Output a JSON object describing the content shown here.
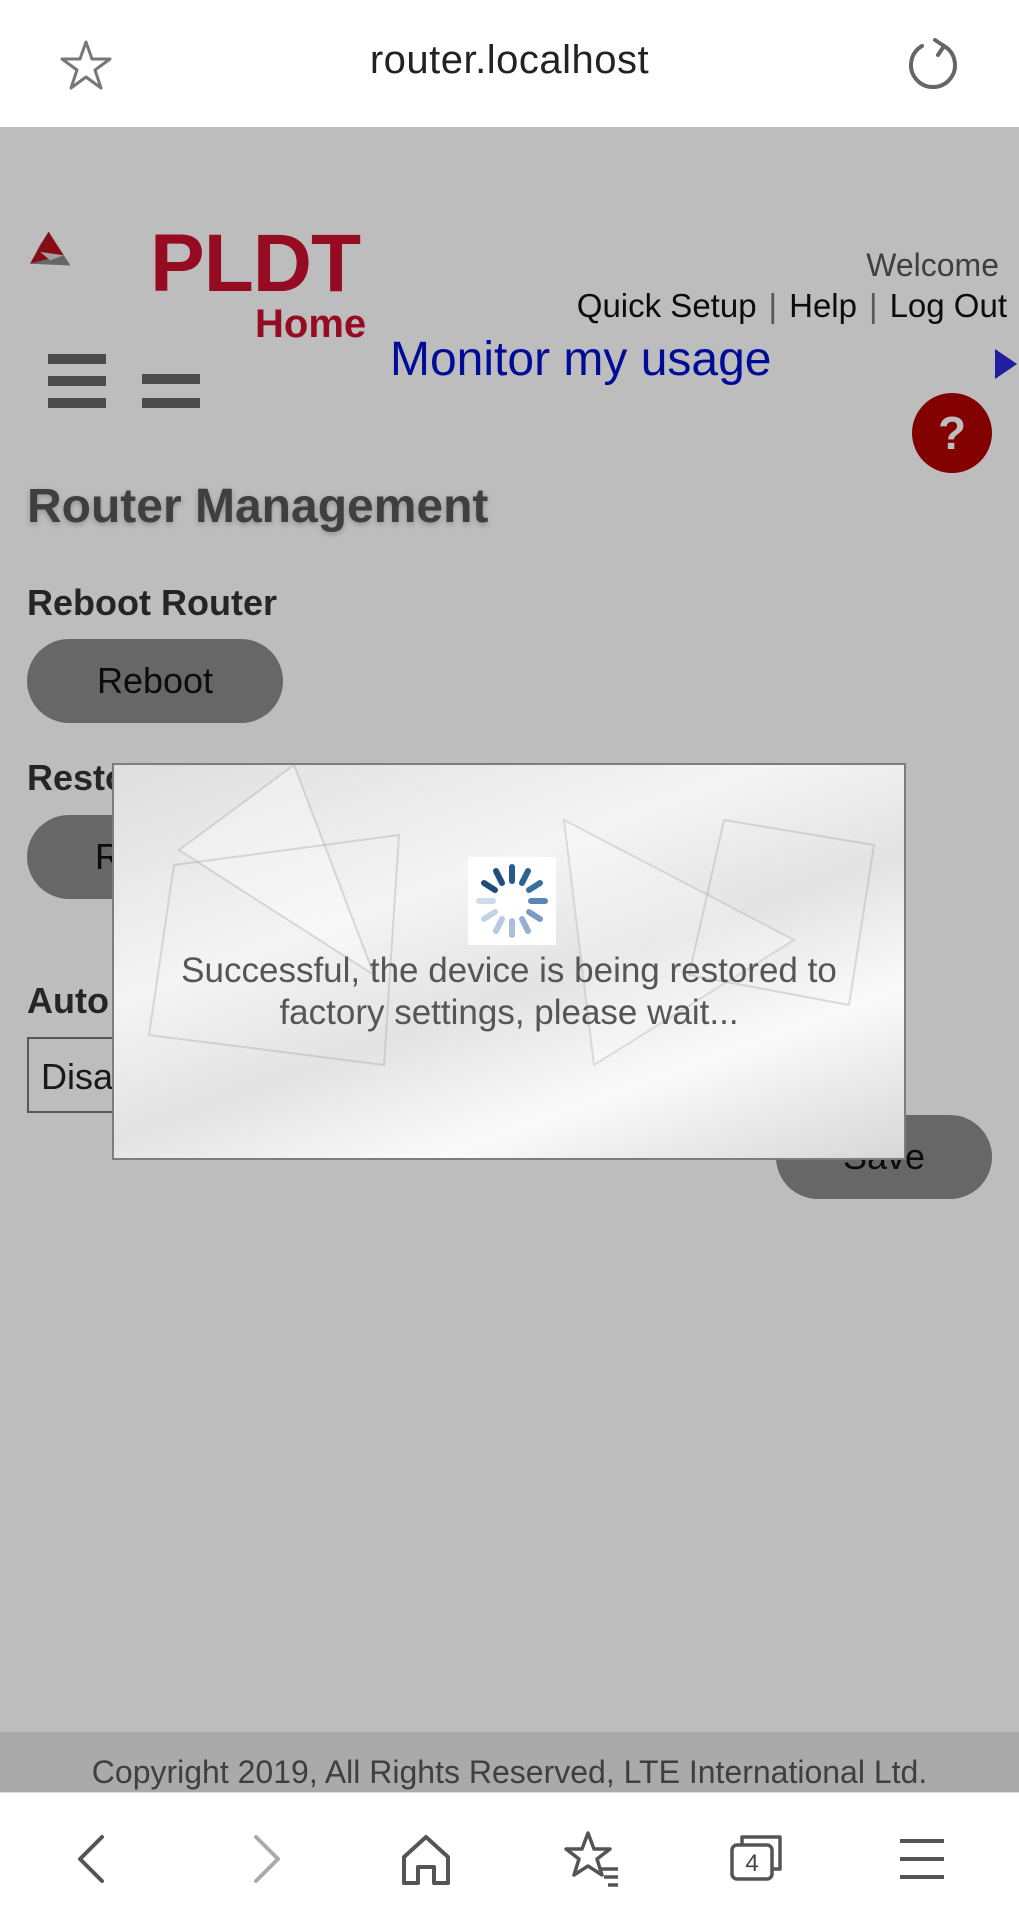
{
  "browser": {
    "url": "router.localhost",
    "tab_count": "4"
  },
  "header": {
    "brand": "PLDT",
    "brand_sub": "Home",
    "welcome": "Welcome",
    "links": [
      "Quick Setup",
      "Help",
      "Log Out"
    ],
    "monitor_link": "Monitor my usage",
    "help_symbol": "?"
  },
  "main": {
    "title": "Router Management",
    "reboot_section_label": "Reboot Router",
    "reboot_button": "Reboot",
    "restore_section_label_partial": "Resto",
    "restore_button_partial": "R",
    "auto_section_label_partial": "Auto",
    "auto_select_value_partial": "Disa",
    "save_button_partial": "Save"
  },
  "modal": {
    "message": "Successful, the device is being restored to factory settings, please wait..."
  },
  "footer": {
    "text": "Copyright 2019, All Rights Reserved, LTE International Ltd."
  },
  "icons": {
    "bookmark": "star-icon",
    "reload": "reload-icon",
    "back": "back-icon",
    "forward": "forward-icon",
    "home": "home-icon",
    "bookmarks": "bookmarks-icon",
    "tabs": "tabs-icon",
    "menu": "menu-icon"
  },
  "colors": {
    "brand_red": "#c8102e",
    "link_blue": "#0011cc",
    "help_red": "#b00000"
  }
}
